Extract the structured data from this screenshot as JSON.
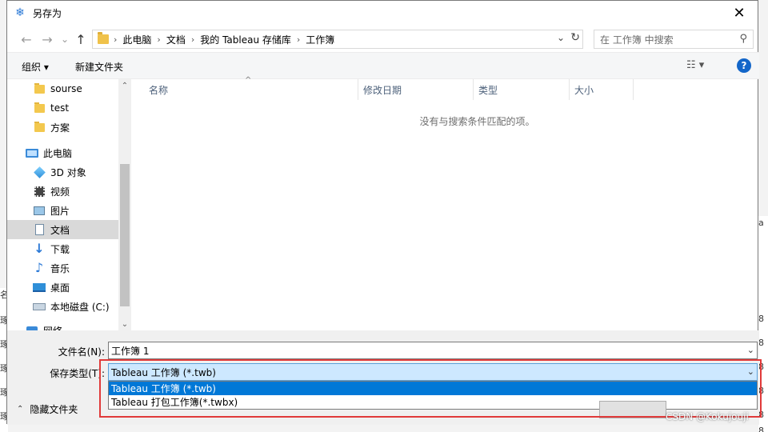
{
  "window": {
    "title": "另存为",
    "close_glyph": "✕",
    "app_icon_glyph": "❄"
  },
  "nav": {
    "back_glyph": "←",
    "forward_glyph": "→",
    "recent_glyph": "⌄",
    "up_glyph": "↑",
    "breadcrumb": [
      "此电脑",
      "文档",
      "我的 Tableau 存储库",
      "工作簿"
    ],
    "breadcrumb_sep": "›",
    "dropdown_glyph": "⌄",
    "refresh_glyph": "↻",
    "search_placeholder": "在 工作簿 中搜索",
    "search_glyph": "⚲"
  },
  "toolbar": {
    "organize": "组织 ▾",
    "new_folder": "新建文件夹",
    "view_glyph": "☷ ▾",
    "help_glyph": "?"
  },
  "sidebar": {
    "items": [
      {
        "label": "sourse",
        "icon": "folder-icon"
      },
      {
        "label": "test",
        "icon": "folder-icon"
      },
      {
        "label": "方案",
        "icon": "folder-icon"
      },
      {
        "label": "此电脑",
        "icon": "computer-icon"
      },
      {
        "label": "3D 对象",
        "icon": "3d-objects-icon"
      },
      {
        "label": "视频",
        "icon": "video-icon"
      },
      {
        "label": "图片",
        "icon": "pictures-icon"
      },
      {
        "label": "文档",
        "icon": "documents-icon",
        "selected": true
      },
      {
        "label": "下载",
        "icon": "download-icon"
      },
      {
        "label": "音乐",
        "icon": "music-icon"
      },
      {
        "label": "桌面",
        "icon": "desktop-icon"
      },
      {
        "label": "本地磁盘 (C:)",
        "icon": "drive-icon"
      },
      {
        "label": "网络",
        "icon": "network-icon"
      }
    ],
    "scroll_up_glyph": "⌃",
    "scroll_down_glyph": "⌄"
  },
  "file_list": {
    "columns": [
      "名称",
      "修改日期",
      "类型",
      "大小"
    ],
    "sort_caret": "^",
    "empty_message": "没有与搜索条件匹配的项。"
  },
  "form": {
    "filename_label": "文件名(N):",
    "filename_value": "工作簿 1",
    "filetype_label": "保存类型(T):",
    "filetype_value": "Tableau 工作簿 (*.twb)",
    "filetype_options": [
      "Tableau 工作簿 (*.twb)",
      "Tableau 打包工作簿(*.twbx)"
    ],
    "hide_folders": "隐藏文件夹",
    "hide_glyph": "⌃",
    "dropdown_glyph": "⌄"
  },
  "background": {
    "right_digits": [
      "8",
      "8",
      "8",
      "8",
      "8",
      "8"
    ],
    "left_chars": [
      "名",
      "琢",
      "琢",
      "琢",
      "琢",
      "琢"
    ],
    "right_header": "a"
  },
  "watermark": "CSDN @Kokujouji",
  "colors": {
    "accent": "#0078d7",
    "highlight_box": "#e03a3a",
    "selected_select_bg": "#cde8ff"
  }
}
